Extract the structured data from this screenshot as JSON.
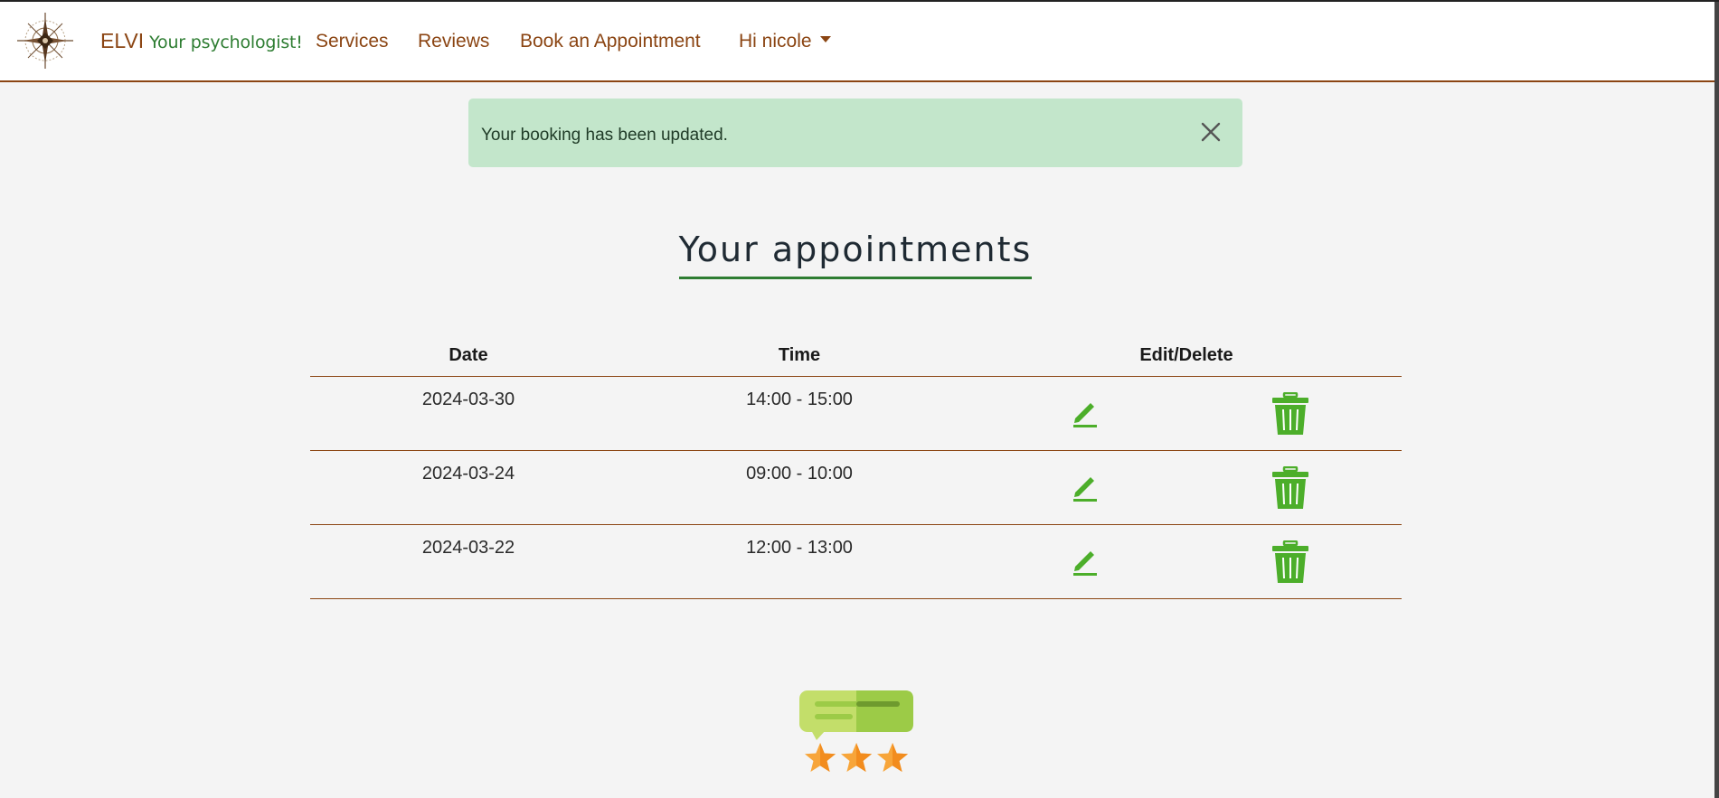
{
  "navbar": {
    "brand_name": "ELVI",
    "brand_tagline": "Your psychologist!",
    "items": [
      {
        "label": "Services"
      },
      {
        "label": "Reviews"
      },
      {
        "label": "Book an Appointment"
      }
    ],
    "user_menu_label": "Hi nicole",
    "logo_icon": "compass-rose-icon"
  },
  "alert": {
    "message": "Your booking has been updated.",
    "close_icon": "close-icon"
  },
  "page": {
    "title": "Your appointments"
  },
  "appointments_table": {
    "headers": {
      "date": "Date",
      "time": "Time",
      "actions": "Edit/Delete"
    },
    "rows": [
      {
        "date": "2024-03-30",
        "time": "14:00 - 15:00"
      },
      {
        "date": "2024-03-24",
        "time": "09:00 - 10:00"
      },
      {
        "date": "2024-03-22",
        "time": "12:00 - 13:00"
      }
    ],
    "edit_icon": "pencil-icon",
    "delete_icon": "trash-icon"
  },
  "colors": {
    "brand_brown": "#8b4513",
    "accent_green": "#2e7d32",
    "icon_green": "#4cae2a",
    "alert_bg": "#c3e6cb",
    "page_bg": "#f4f4f4"
  }
}
